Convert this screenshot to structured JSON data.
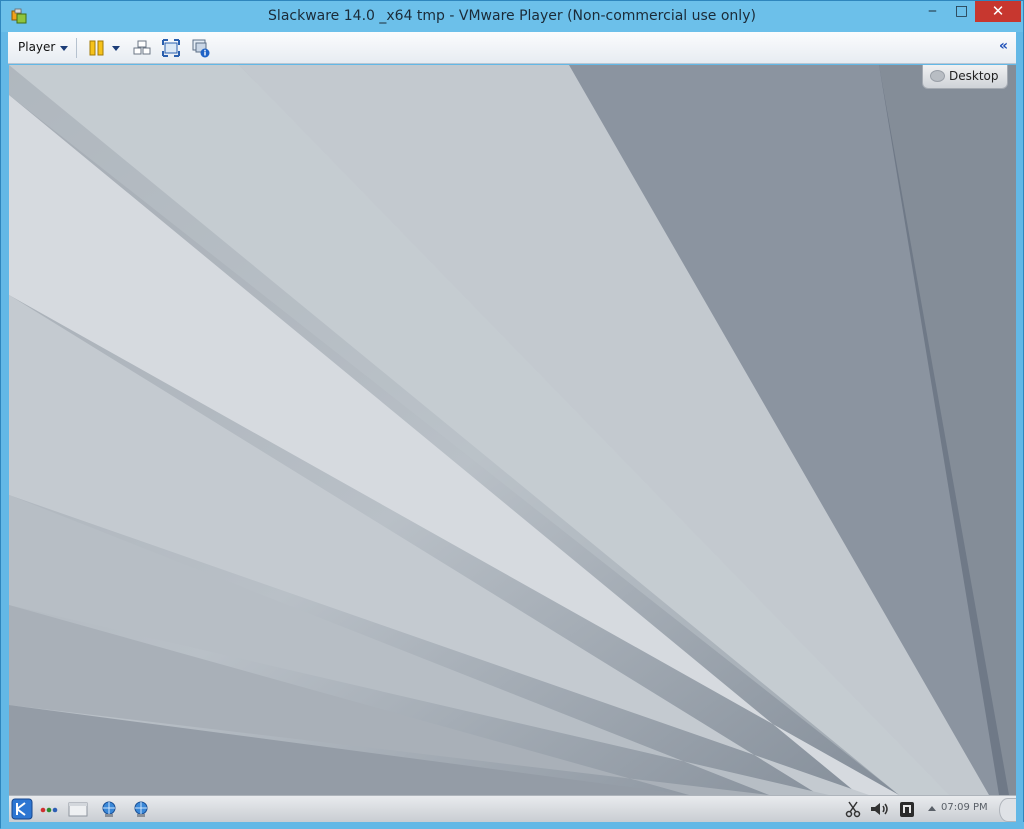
{
  "window": {
    "title": "Slackware 14.0 _x64  tmp - VMware Player (Non-commercial use only)",
    "minimize_label": "‒",
    "maximize_label": "□",
    "close_label": "✕"
  },
  "toolbar": {
    "player_menu_label": "Player",
    "items": [
      "pause-icon",
      "send-ctrl-alt-del-icon",
      "fullscreen-icon",
      "unity-icon"
    ],
    "collapse_label": "«"
  },
  "guest": {
    "desktop_button_label": "Desktop",
    "panel": {
      "clock": "07:09 PM",
      "items": [
        "kde-menu-icon",
        "activity-dots-icon",
        "desktop-folder-icon",
        "network-globe-icon",
        "network-globe-icon",
        "clipboard-scissors-icon",
        "volume-icon",
        "device-notifier-icon",
        "tray-arrow-icon"
      ]
    }
  },
  "colors": {
    "titlebar": "#6cc0ea",
    "close_button": "#c7372f",
    "wallpaper_base": "#8f98a3"
  }
}
